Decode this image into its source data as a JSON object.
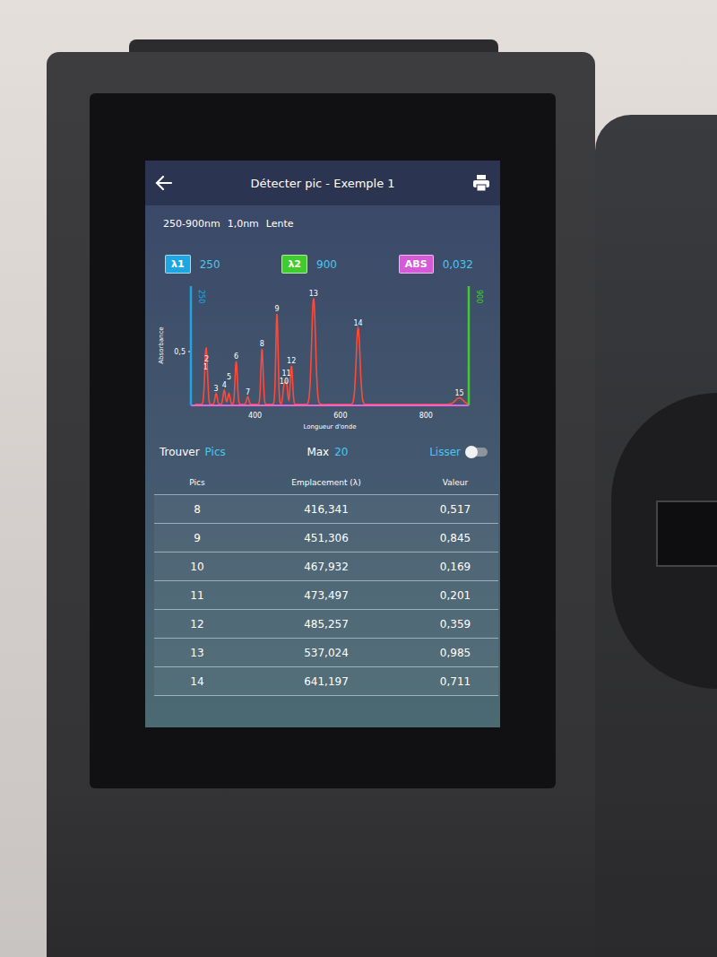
{
  "header": {
    "title": "Détecter pic - Exemple 1"
  },
  "scan": {
    "range": "250-900nm",
    "step": "1,0nm",
    "speed": "Lente"
  },
  "markers": [
    {
      "label": "λ1",
      "value": "250",
      "color": "#1fa6e0"
    },
    {
      "label": "λ2",
      "value": "900",
      "color": "#3fcc2c"
    },
    {
      "label": "ABS",
      "value": "0,032",
      "color": "#d45ad6"
    }
  ],
  "chart": {
    "y_axis_label": "Absorbance",
    "x_axis_label": "Longueur d'onde",
    "x_ticks": [
      "400",
      "600",
      "800"
    ],
    "y_ticks": [
      "0,5"
    ],
    "x_min": 250,
    "x_max": 900,
    "cursors": [
      {
        "label": "250",
        "wavelength": 250,
        "color": "#1fa6e0"
      },
      {
        "label": "900",
        "wavelength": 900,
        "color": "#3fcc2c"
      }
    ],
    "peaks": [
      {
        "label": "1",
        "wavelength": 284,
        "value": 0.3
      },
      {
        "label": "2",
        "wavelength": 287,
        "value": 0.32
      },
      {
        "label": "3",
        "wavelength": 309,
        "value": 0.1
      },
      {
        "label": "4",
        "wavelength": 328,
        "value": 0.13
      },
      {
        "label": "5",
        "wavelength": 339,
        "value": 0.1
      },
      {
        "label": "6",
        "wavelength": 356,
        "value": 0.4
      },
      {
        "label": "7",
        "wavelength": 383,
        "value": 0.07
      },
      {
        "label": "8",
        "wavelength": 416.341,
        "value": 0.517
      },
      {
        "label": "9",
        "wavelength": 451.306,
        "value": 0.845
      },
      {
        "label": "10",
        "wavelength": 467.932,
        "value": 0.169
      },
      {
        "label": "11",
        "wavelength": 473.497,
        "value": 0.201
      },
      {
        "label": "12",
        "wavelength": 485.257,
        "value": 0.359
      },
      {
        "label": "13",
        "wavelength": 537.024,
        "value": 0.985
      },
      {
        "label": "14",
        "wavelength": 641.197,
        "value": 0.711
      },
      {
        "label": "15",
        "wavelength": 878,
        "value": 0.06
      }
    ]
  },
  "controls": {
    "find_label": "Trouver",
    "find_value": "Pics",
    "max_label": "Max",
    "max_value": "20",
    "smooth_label": "Lisser",
    "smooth_on": false
  },
  "table": {
    "columns": [
      "Pics",
      "Emplacement (λ)",
      "Valeur"
    ],
    "rows": [
      {
        "peak": "8",
        "location": "416,341",
        "value": "0,517"
      },
      {
        "peak": "9",
        "location": "451,306",
        "value": "0,845"
      },
      {
        "peak": "10",
        "location": "467,932",
        "value": "0,169"
      },
      {
        "peak": "11",
        "location": "473,497",
        "value": "0,201"
      },
      {
        "peak": "12",
        "location": "485,257",
        "value": "0,359"
      },
      {
        "peak": "13",
        "location": "537,024",
        "value": "0,985"
      },
      {
        "peak": "14",
        "location": "641,197",
        "value": "0,711"
      }
    ]
  }
}
